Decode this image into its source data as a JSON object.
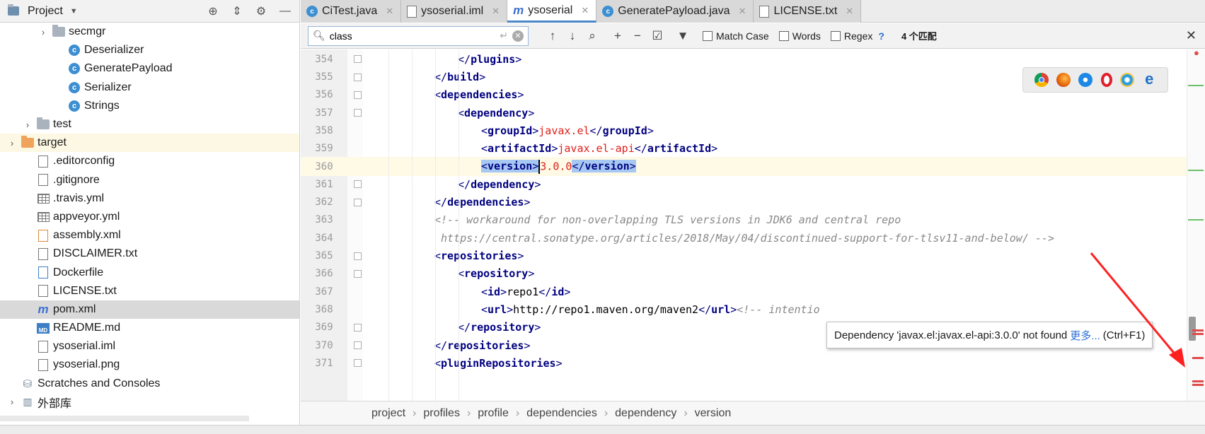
{
  "project": {
    "title": "Project",
    "tree": [
      {
        "label": "secmgr",
        "icon": "folder-icon",
        "indent": 2,
        "arrow": "›"
      },
      {
        "label": "Deserializer",
        "icon": "class-icon",
        "indent": 3
      },
      {
        "label": "GeneratePayload",
        "icon": "class-icon",
        "indent": 3
      },
      {
        "label": "Serializer",
        "icon": "class-icon",
        "indent": 3
      },
      {
        "label": "Strings",
        "icon": "class-icon",
        "indent": 3
      },
      {
        "label": "test",
        "icon": "folder-icon",
        "indent": 1,
        "arrow": "›"
      },
      {
        "label": "target",
        "icon": "folder-orange-icon",
        "indent": 0,
        "arrow": "›"
      },
      {
        "label": ".editorconfig",
        "icon": "file-icon",
        "indent": 1
      },
      {
        "label": ".gitignore",
        "icon": "file-icon",
        "indent": 1
      },
      {
        "label": ".travis.yml",
        "icon": "grid-file-icon",
        "indent": 1
      },
      {
        "label": "appveyor.yml",
        "icon": "grid-file-icon",
        "indent": 1
      },
      {
        "label": "assembly.xml",
        "icon": "xml-file-icon",
        "indent": 1
      },
      {
        "label": "DISCLAIMER.txt",
        "icon": "file-icon",
        "indent": 1
      },
      {
        "label": "Dockerfile",
        "icon": "docker-file-icon",
        "indent": 1
      },
      {
        "label": "LICENSE.txt",
        "icon": "file-icon",
        "indent": 1
      },
      {
        "label": "pom.xml",
        "icon": "maven-icon",
        "indent": 1
      },
      {
        "label": "README.md",
        "icon": "markdown-icon",
        "indent": 1
      },
      {
        "label": "ysoserial.iml",
        "icon": "file-icon",
        "indent": 1
      },
      {
        "label": "ysoserial.png",
        "icon": "file-icon",
        "indent": 1
      },
      {
        "label": "Scratches and Consoles",
        "icon": "scratches-icon",
        "indent": 0
      },
      {
        "label": "外部库",
        "icon": "library-icon",
        "indent": 0,
        "arrow": "›"
      }
    ]
  },
  "tabs": [
    {
      "label": "CiTest.java",
      "icon": "C"
    },
    {
      "label": "ysoserial.iml",
      "icon": "iml"
    },
    {
      "label": "ysoserial",
      "icon": "m",
      "active": true
    },
    {
      "label": "GeneratePayload.java",
      "icon": "C"
    },
    {
      "label": "LICENSE.txt",
      "icon": "txt"
    }
  ],
  "search": {
    "value": "class",
    "match_case": "Match Case",
    "words": "Words",
    "regex": "Regex",
    "help": "?",
    "count": "4 个匹配"
  },
  "editor": {
    "lines": [
      {
        "n": "354",
        "indent": 3,
        "html": "<span class='br'>&lt;/</span><span class='tag'>plugins</span><span class='br'>&gt;</span>"
      },
      {
        "n": "355",
        "indent": 2,
        "html": "<span class='br'>&lt;/</span><span class='tag'>build</span><span class='br'>&gt;</span>"
      },
      {
        "n": "356",
        "indent": 2,
        "html": "<span class='br'>&lt;</span><span class='tag'>dependencies</span><span class='br'>&gt;</span>"
      },
      {
        "n": "357",
        "indent": 3,
        "html": "<span class='br'>&lt;</span><span class='tag'>dependency</span><span class='br'>&gt;</span>"
      },
      {
        "n": "358",
        "indent": 4,
        "html": "<span class='br'>&lt;</span><span class='tag'>groupId</span><span class='br'>&gt;</span><span class='val'>javax.el</span><span class='br'>&lt;/</span><span class='tag'>groupId</span><span class='br'>&gt;</span>"
      },
      {
        "n": "359",
        "indent": 4,
        "html": "<span class='br'>&lt;</span><span class='tag'>artifactId</span><span class='br'>&gt;</span><span class='val'>javax.el-api</span><span class='br'>&lt;/</span><span class='tag'>artifactId</span><span class='br'>&gt;</span>"
      },
      {
        "n": "360",
        "indent": 4,
        "current": true,
        "html": "<span class='sel'><span class='br'>&lt;</span><span class='tag'>version</span><span class='br'>&gt;</span></span><span class='caret'></span><span class='val'>3.0.0</span><span class='sel'><span class='br'>&lt;/</span><span class='tag'>version</span><span class='br'>&gt;</span></span>"
      },
      {
        "n": "361",
        "indent": 3,
        "html": "<span class='br'>&lt;/</span><span class='tag'>dependency</span><span class='br'>&gt;</span>"
      },
      {
        "n": "362",
        "indent": 2,
        "html": "<span class='br'>&lt;/</span><span class='tag'>dependencies</span><span class='br'>&gt;</span>"
      },
      {
        "n": "363",
        "indent": 2,
        "html": "<span class='comment'>&lt;!-- workaround for non-overlapping TLS versions in JDK6 and central repo</span>"
      },
      {
        "n": "364",
        "indent": 2,
        "html": "<span class='comment'> https://central.sonatype.org/articles/2018/May/04/discontinued-support-for-tlsv11-and-below/ --&gt;</span>"
      },
      {
        "n": "365",
        "indent": 2,
        "html": "<span class='br'>&lt;</span><span class='tag'>repositories</span><span class='br'>&gt;</span>"
      },
      {
        "n": "366",
        "indent": 3,
        "html": "<span class='br'>&lt;</span><span class='tag'>repository</span><span class='br'>&gt;</span>"
      },
      {
        "n": "367",
        "indent": 4,
        "html": "<span class='br'>&lt;</span><span class='tag'>id</span><span class='br'>&gt;</span><span class='plain'>repo1</span><span class='br'>&lt;/</span><span class='tag'>id</span><span class='br'>&gt;</span>"
      },
      {
        "n": "368",
        "indent": 4,
        "html": "<span class='br'>&lt;</span><span class='tag'>url</span><span class='br'>&gt;</span><span class='plain'>http://repo1.maven.org/maven2</span><span class='br'>&lt;/</span><span class='tag'>url</span><span class='br'>&gt;</span><span class='comment'>&lt;!-- intentio</span>"
      },
      {
        "n": "369",
        "indent": 3,
        "html": "<span class='br'>&lt;/</span><span class='tag'>repository</span><span class='br'>&gt;</span>"
      },
      {
        "n": "370",
        "indent": 2,
        "html": "<span class='br'>&lt;/</span><span class='tag'>repositories</span><span class='br'>&gt;</span>"
      },
      {
        "n": "371",
        "indent": 2,
        "html": "<span class='br'>&lt;</span><span class='tag'>pluginRepositories</span><span class='br'>&gt;</span>"
      }
    ]
  },
  "tooltip": {
    "text": "Dependency 'javax.el:javax.el-api:3.0.0' not found",
    "more": "更多...",
    "shortcut": "(Ctrl+F1)"
  },
  "breadcrumbs": [
    "project",
    "profiles",
    "profile",
    "dependencies",
    "dependency",
    "version"
  ],
  "colors": {
    "tag": "#000080",
    "value": "#e0201b",
    "comment": "#888888",
    "accent": "#4a88c7",
    "error": "#e04b4b",
    "arrow": "#ff2020"
  }
}
